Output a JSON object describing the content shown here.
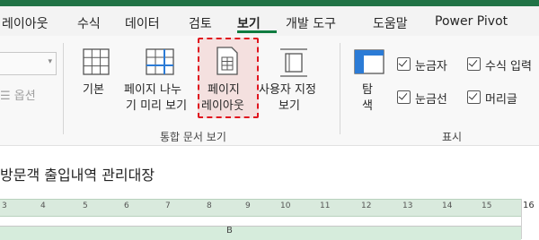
{
  "menu": {
    "tabs": [
      {
        "label": "레이아웃"
      },
      {
        "label": "수식"
      },
      {
        "label": "데이터"
      },
      {
        "label": "검토"
      },
      {
        "label": "보기"
      },
      {
        "label": "개발 도구"
      },
      {
        "label": "도움말"
      },
      {
        "label": "Power Pivot"
      }
    ],
    "active_tab": "보기"
  },
  "ribbon": {
    "options_label": "옵션",
    "workbook_views": {
      "normal": {
        "line1": "기본"
      },
      "page_break": {
        "line1": "페이지 나누",
        "line2": "기 미리 보기"
      },
      "page_layout": {
        "line1": "페이지",
        "line2": "레이아웃"
      },
      "custom": {
        "line1": "사용자 지정",
        "line2": "보기"
      },
      "group_label": "통합 문서 보기"
    },
    "show": {
      "ruler": {
        "line1": "탐",
        "line2": "색"
      },
      "checkboxes": [
        {
          "label": "눈금자",
          "checked": true
        },
        {
          "label": "수식 입력",
          "checked": true
        },
        {
          "label": "눈금선",
          "checked": true
        },
        {
          "label": "머리글",
          "checked": true
        }
      ],
      "group_label": "표시"
    }
  },
  "sheet": {
    "title": "방문객 출입내역 관리대장",
    "ruler_ticks": [
      "3",
      "4",
      "5",
      "6",
      "7",
      "8",
      "9",
      "10",
      "11",
      "12",
      "13",
      "14",
      "15"
    ],
    "right_number": "16",
    "column_letter": "B"
  },
  "colors": {
    "accent": "#217346",
    "highlight": "#e0141e"
  }
}
